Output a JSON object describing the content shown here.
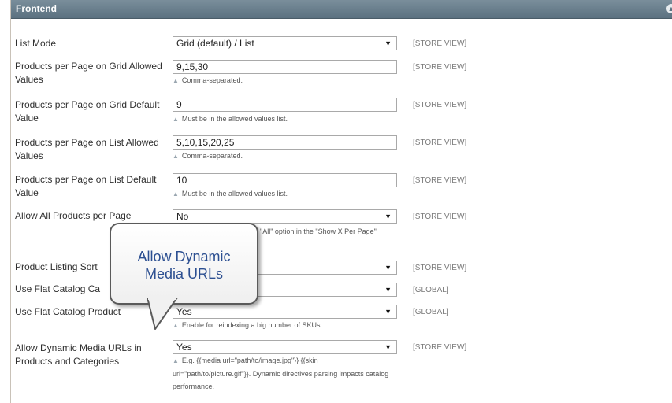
{
  "header": {
    "title": "Frontend"
  },
  "rows": [
    {
      "label": "List Mode",
      "value": "Grid (default) / List",
      "type": "select",
      "scope": "[STORE VIEW]"
    },
    {
      "label": "Products per Page on Grid Allowed Values",
      "value": "9,15,30",
      "type": "input",
      "note": "Comma-separated.",
      "scope": "[STORE VIEW]"
    },
    {
      "label": "Products per Page on Grid Default Value",
      "value": "9",
      "type": "input",
      "note": "Must be in the allowed values list.",
      "scope": "[STORE VIEW]"
    },
    {
      "label": "Products per Page on List Allowed Values",
      "value": "5,10,15,20,25",
      "type": "input",
      "note": "Comma-separated.",
      "scope": "[STORE VIEW]"
    },
    {
      "label": "Products per Page on List Default Value",
      "value": "10",
      "type": "input",
      "note": "Must be in the allowed values list.",
      "scope": "[STORE VIEW]"
    },
    {
      "label": "Allow All Products per Page",
      "value": "No",
      "type": "select",
      "note": "\"All\" option in the \"Show X Per Page\"",
      "scope": "[STORE VIEW]"
    },
    {
      "label": "Product Listing Sort",
      "value": "",
      "type": "select",
      "scope": "[STORE VIEW]"
    },
    {
      "label": "Use Flat Catalog Ca",
      "value": "",
      "type": "select",
      "scope": "[GLOBAL]"
    },
    {
      "label": "Use Flat Catalog Product",
      "value": "Yes",
      "type": "select",
      "note": "Enable for reindexing a big number of SKUs.",
      "scope": "[GLOBAL]"
    },
    {
      "label": "Allow Dynamic Media URLs in Products and Categories",
      "value": "Yes",
      "type": "select",
      "note": "E.g. {{media url=\"path/to/image.jpg\"}} {{skin url=\"path/to/picture.gif\"}}. Dynamic directives parsing impacts catalog performance.",
      "scope": "[STORE VIEW]"
    }
  ],
  "callout": {
    "text_line1": "Allow Dynamic",
    "text_line2": "Media URLs"
  },
  "icons": {
    "collapse": "collapse-icon",
    "dropdown": "chevron-down-icon",
    "note": "triangle-up-icon"
  }
}
